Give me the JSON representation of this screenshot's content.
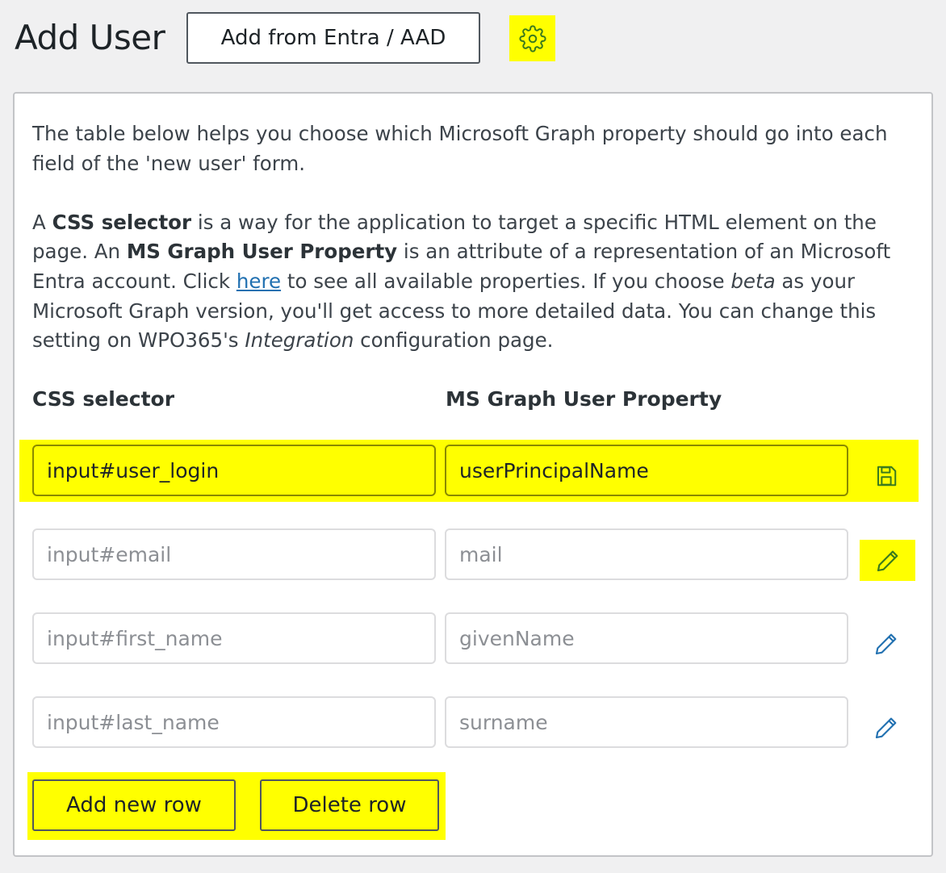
{
  "header": {
    "title": "Add User",
    "add_button_label": "Add from Entra / AAD",
    "settings_icon": "gear-icon"
  },
  "intro": {
    "p1": "The table below helps you choose which Microsoft Graph property should go into each field of the 'new user' form.",
    "p2_a": "A ",
    "p2_b": "CSS selector",
    "p2_c": " is a way for the application to target a specific HTML element on the page. An ",
    "p2_d": "MS Graph User Property",
    "p2_e": " is an attribute of a representation of an Microsoft Entra account. Click ",
    "p2_link": "here",
    "p2_f": " to see all available properties. If you choose ",
    "p2_g": "beta",
    "p2_h": " as your Microsoft Graph version, you'll get access to more detailed data. You can change this setting on WPO365's ",
    "p2_i": "Integration",
    "p2_j": " configuration page."
  },
  "table": {
    "col_selector": "CSS selector",
    "col_property": "MS Graph User Property",
    "rows": [
      {
        "selector": "input#user_login",
        "property": "userPrincipalName",
        "selector_placeholder": "",
        "property_placeholder": "",
        "action_icon": "save-icon"
      },
      {
        "selector": "",
        "property": "",
        "selector_placeholder": "input#email",
        "property_placeholder": "mail",
        "action_icon": "pencil-icon"
      },
      {
        "selector": "",
        "property": "",
        "selector_placeholder": "input#first_name",
        "property_placeholder": "givenName",
        "action_icon": "pencil-icon"
      },
      {
        "selector": "",
        "property": "",
        "selector_placeholder": "input#last_name",
        "property_placeholder": "surname",
        "action_icon": "pencil-icon"
      }
    ]
  },
  "footer": {
    "add_row_label": "Add new row",
    "delete_row_label": "Delete row"
  },
  "colors": {
    "highlight": "#ffff00",
    "link": "#2271b1",
    "icon_active": "#3a7a1e",
    "icon_default": "#2271b1"
  }
}
